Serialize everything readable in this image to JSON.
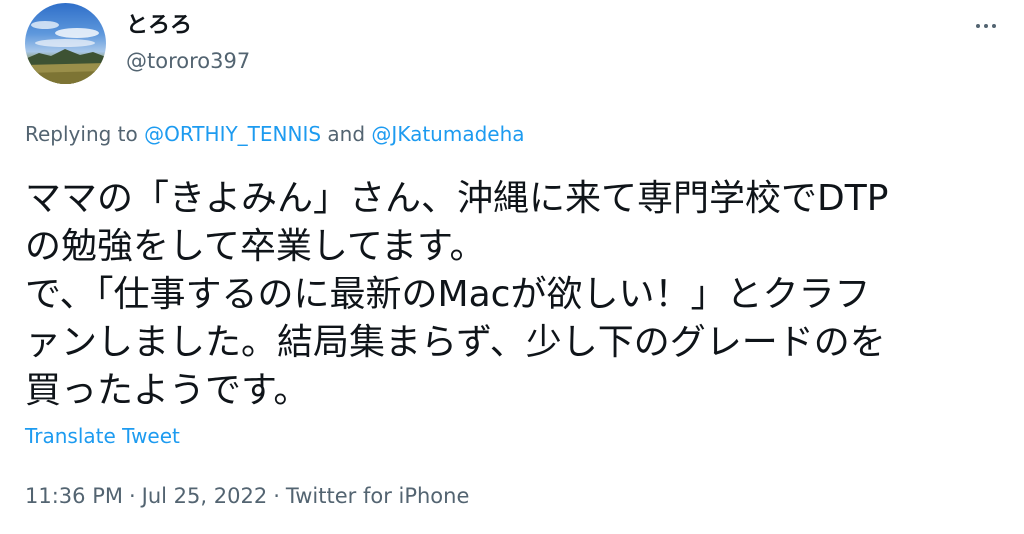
{
  "author": {
    "display_name": "とろろ",
    "handle": "@tororo397",
    "avatar_icon": "landscape-avatar-icon"
  },
  "more_icon": "more-horizontal-icon",
  "reply_context": {
    "prefix": "Replying to",
    "mention_1": "@ORTHIY_TENNIS",
    "conjunction": "and",
    "mention_2": "@JKatumadeha"
  },
  "tweet": {
    "lines": [
      "ママの「きよみん」さん、沖縄に来て専門学校でDTP",
      "の勉強をして卒業してます。",
      "で、「仕事するのに最新のMacが欲しい！」とクラフ",
      "ァンしました。結局集まらず、少し下のグレードのを",
      "買ったようです。"
    ]
  },
  "translate_label": "Translate Tweet",
  "meta": {
    "time": "11:36 PM",
    "separator": "·",
    "date": "Jul 25, 2022",
    "source": "Twitter for iPhone"
  },
  "colors": {
    "text_primary": "#0f1419",
    "text_secondary": "#536471",
    "link": "#1d9bf0"
  }
}
